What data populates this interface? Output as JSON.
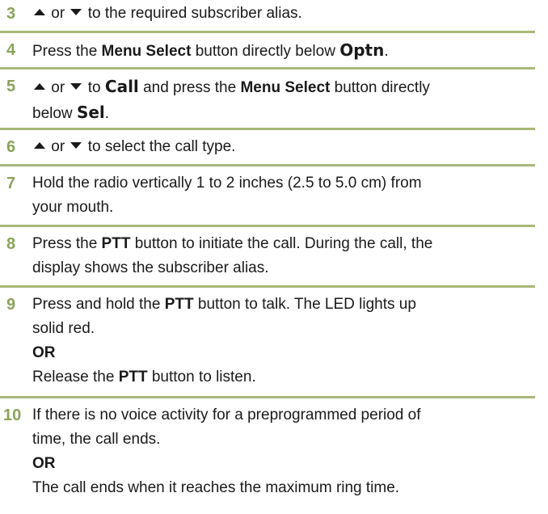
{
  "steps": [
    {
      "num": "3",
      "or_word": "or",
      "text": "to the required subscriber alias."
    },
    {
      "num": "4",
      "pre": "Press the",
      "key": "Menu Select",
      "post": "button directly below",
      "display": "Optn",
      "end": "."
    },
    {
      "num": "5",
      "or_word": "or",
      "to_word": "to",
      "display1": "Call",
      "mid": "and press the",
      "key": "Menu Select",
      "post": "button directly",
      "line2_pre": "below",
      "display2": "Sel",
      "end": "."
    },
    {
      "num": "6",
      "or_word": "or",
      "text": "to select the call type."
    },
    {
      "num": "7",
      "line1": "Hold the radio vertically 1 to 2 inches (2.5 to 5.0 cm) from",
      "line2": "your mouth."
    },
    {
      "num": "8",
      "pre": "Press the",
      "key": "PTT",
      "post": "button to initiate the call. During the call, the",
      "line2": "display shows the subscriber alias."
    },
    {
      "num": "9",
      "pre": "Press and hold the",
      "key": "PTT",
      "post": "button to talk. The LED lights up",
      "line2": "solid red.",
      "or": "OR",
      "alt_pre": "Release the",
      "alt_key": "PTT",
      "alt_post": "button to listen."
    },
    {
      "num": "10",
      "line1": "If there is no voice activity for a preprogrammed period of",
      "line2": "time, the call ends.",
      "or": "OR",
      "alt": "The call ends when it reaches the maximum ring time."
    }
  ],
  "icons": {
    "up": "up-arrow-icon",
    "down": "down-arrow-icon"
  },
  "colors": {
    "step_number": "#8aa35a",
    "divider": "#a8b878",
    "text": "#1a1a1a"
  }
}
